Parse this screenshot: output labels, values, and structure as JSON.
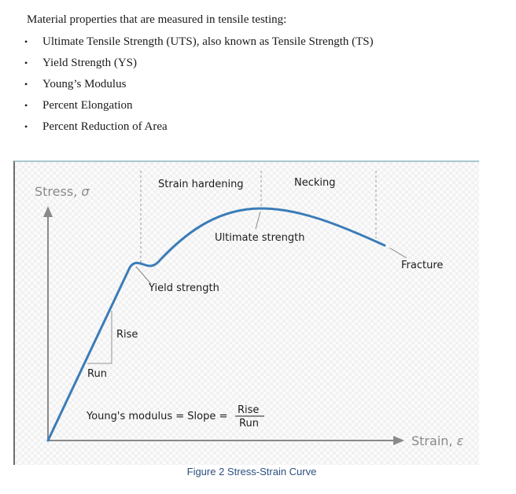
{
  "intro": "Material properties that are measured in tensile testing:",
  "bullet_glyph": "•",
  "bullets": [
    "Ultimate Tensile Strength (UTS), also known as Tensile Strength (TS)",
    "Yield Strength (YS)",
    "Young’s Modulus",
    "Percent Elongation",
    "Percent Reduction of Area"
  ],
  "figure": {
    "y_axis_label": "Stress, ",
    "y_axis_symbol": "σ",
    "x_axis_label": "Strain, ",
    "x_axis_symbol": "ε",
    "regions": {
      "strain_hardening": "Strain hardening",
      "necking": "Necking"
    },
    "annotations": {
      "ultimate_strength": "Ultimate strength",
      "yield_strength": "Yield strength",
      "fracture": "Fracture",
      "rise": "Rise",
      "run": "Run"
    },
    "formula": {
      "lhs": "Young's modulus = Slope =",
      "numerator": "Rise",
      "denominator": "Run"
    },
    "curve_color": "#3a7cb8",
    "axis_color": "#8a8a8a",
    "caption": "Figure 2 Stress-Strain Curve"
  }
}
